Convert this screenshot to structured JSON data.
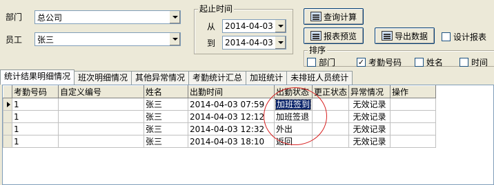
{
  "filters": {
    "dept_label": "部门",
    "dept_value": "总公司",
    "employee_label": "员工",
    "employee_value": "张三"
  },
  "time_range": {
    "title": "起止时间",
    "from_label": "从",
    "from_value": "2014-04-03",
    "to_label": "到",
    "to_value": "2014-04-03"
  },
  "buttons": {
    "query": "查询计算",
    "report_preview": "报表预览",
    "export": "导出数据"
  },
  "design_report": {
    "label": "设计报表",
    "checked": false
  },
  "sort": {
    "title": "排序",
    "options": [
      {
        "label": "部门",
        "checked": false
      },
      {
        "label": "考勤号码",
        "checked": true
      },
      {
        "label": "姓名",
        "checked": false
      },
      {
        "label": "时间",
        "checked": false
      }
    ]
  },
  "tabs": [
    "统计结果明细情况",
    "班次明细情况",
    "其他异常情况",
    "考勤统计汇总",
    "加班统计",
    "未排班人员统计"
  ],
  "grid": {
    "columns": [
      "考勤号码",
      "自定义编号",
      "姓名",
      "出勤时间",
      "出勤状态",
      "更正状态",
      "异常情况",
      "操作"
    ],
    "rows": [
      [
        "1",
        "",
        "张三",
        "2014-04-03 07:59",
        "加班签到",
        "",
        "无效记录",
        ""
      ],
      [
        "1",
        "",
        "张三",
        "2014-04-03 12:12",
        "加班签退",
        "",
        "无效记录",
        ""
      ],
      [
        "1",
        "",
        "张三",
        "2014-04-03 12:32",
        "外出",
        "",
        "无效记录",
        ""
      ],
      [
        "1",
        "",
        "张三",
        "2014-04-03 18:10",
        "返回",
        "",
        "无效记录",
        ""
      ]
    ]
  },
  "colors": {
    "highlight_circle": "#d82020",
    "selection": "#0a246a"
  }
}
